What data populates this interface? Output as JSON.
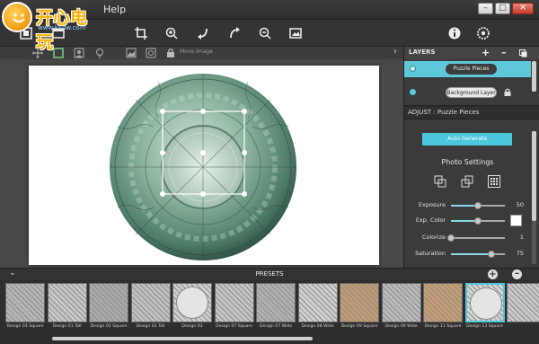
{
  "app": {
    "logo_text": "开心电玩",
    "logo_url": "www.kxdw.com",
    "menu_visible": "Help"
  },
  "window": {
    "minimize": "–",
    "maximize": "□",
    "close": "✕"
  },
  "toolbar": {
    "icons": [
      "crop-frame-icon",
      "image-layer-icon",
      "crop-icon",
      "zoom-in-icon",
      "rotate-left-icon",
      "rotate-right-icon",
      "zoom-out-icon",
      "image-icon",
      "info-icon",
      "settings-icon"
    ]
  },
  "subtoolbar": {
    "move_image_label": "Move Image",
    "collapse_glyph": "›"
  },
  "layers": {
    "title": "LAYERS",
    "add": "+",
    "remove": "–",
    "items": [
      {
        "label": "Puzzle Pieces",
        "selected": true
      },
      {
        "label": "Background Layer",
        "selected": false,
        "locked": true
      }
    ]
  },
  "adjust": {
    "title": "ADJUST : Puzzle Pieces",
    "auto_generate": "Auto Generate",
    "photo_settings": "Photo Settings",
    "sliders": [
      {
        "label": "Exposure",
        "value": "50",
        "fraction": 0.5
      },
      {
        "label": "Exp. Color",
        "value": "",
        "fraction": 0.5,
        "swatch": "#ffffff"
      },
      {
        "label": "Colorize",
        "value": "1",
        "fraction": 0.0
      },
      {
        "label": "Saturation",
        "value": "75",
        "fraction": 0.75
      }
    ]
  },
  "presets": {
    "title": "PRESETS",
    "chevron": "⌄",
    "add": "+",
    "remove": "–",
    "items": [
      {
        "label": "Design 01 Square",
        "selected": false
      },
      {
        "label": "Design 01 Tall",
        "selected": false
      },
      {
        "label": "Design 02 Square",
        "selected": false
      },
      {
        "label": "Design 02 Tall",
        "selected": false
      },
      {
        "label": "Design 03",
        "selected": false
      },
      {
        "label": "Design 07 Square",
        "selected": false
      },
      {
        "label": "Design 07 Wide",
        "selected": false
      },
      {
        "label": "Design 08 Wide",
        "selected": false
      },
      {
        "label": "Design 09 Square",
        "selected": false
      },
      {
        "label": "Design 09 Wide",
        "selected": false
      },
      {
        "label": "Design 11 Square",
        "selected": false
      },
      {
        "label": "Design 13 Square",
        "selected": true
      },
      {
        "label": "",
        "selected": false
      }
    ]
  },
  "colors": {
    "accent": "#4dc7dc",
    "layer_selected": "#5ec7d8",
    "puzzle": "#5d8f78"
  }
}
